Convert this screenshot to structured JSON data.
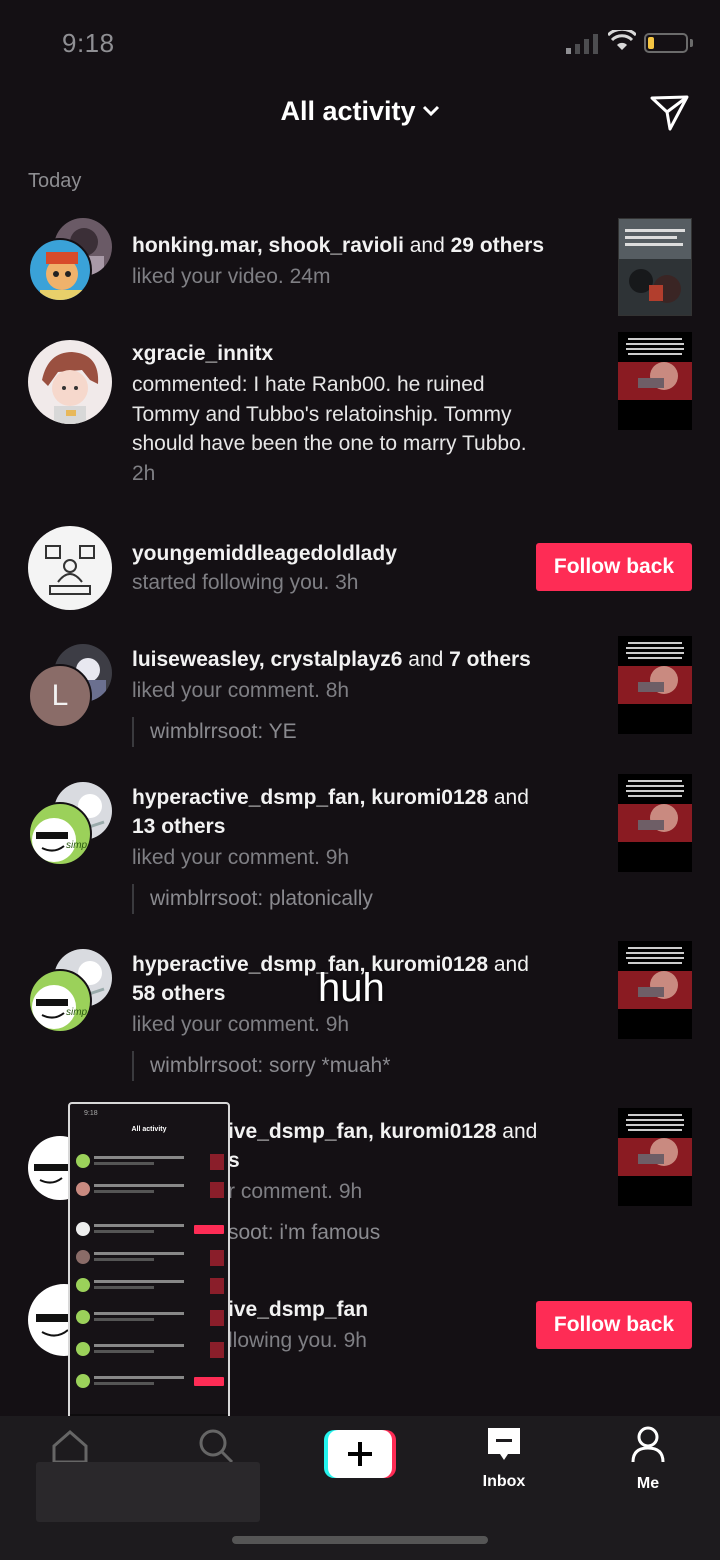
{
  "status_bar": {
    "time": "9:18"
  },
  "header": {
    "title": "All activity",
    "title_icon": "chevron-down-icon",
    "action_icon": "send-icon"
  },
  "section": {
    "today": "Today"
  },
  "activities": [
    {
      "names": "honking.mar, shook_ravioli",
      "and": " and ",
      "others": "29 others",
      "action": "liked your video.",
      "time": "24m"
    },
    {
      "names": "xgracie_innitx",
      "line1": "commented: I hate Ranb00. he ruined",
      "line2": "Tommy and Tubbo's relatoinship. Tommy",
      "line3": "should have been the one to marry Tubbo.",
      "time": "2h"
    },
    {
      "names": "youngemiddleagedoldlady",
      "action": "started following you.",
      "time": "3h",
      "button": "Follow back"
    },
    {
      "names": "luiseweasley, crystalplayz6",
      "and": " and ",
      "others": "7 others",
      "action": "liked your comment.",
      "time": "8h",
      "quote": "wimblrrsoot: YE",
      "avatar_letter": "L"
    },
    {
      "names": "hyperactive_dsmp_fan, kuromi0128",
      "and": " and",
      "others": "13 others",
      "action": "liked your comment.",
      "time": "9h",
      "quote": "wimblrrsoot: platonically",
      "avatar_text": "simp"
    },
    {
      "names": "hyperactive_dsmp_fan, kuromi0128",
      "and": " and",
      "others": "58 others",
      "action": "liked your comment.",
      "time": "9h",
      "quote": "wimblrrsoot: sorry *muah*",
      "avatar_text": "simp"
    },
    {
      "names": "ive_dsmp_fan, kuromi0128",
      "and": " and",
      "others": "s",
      "action": "r comment.",
      "time": "9h",
      "quote": "soot: i'm famous"
    },
    {
      "names": "ive_dsmp_fan",
      "action": "llowing you.",
      "time": "9h",
      "button": "Follow back"
    }
  ],
  "caption": "huh",
  "pip": {
    "time": "9:18",
    "title": "All activity"
  },
  "tabbar": {
    "create_icon": "plus-icon",
    "inbox": "Inbox",
    "me": "Me"
  }
}
